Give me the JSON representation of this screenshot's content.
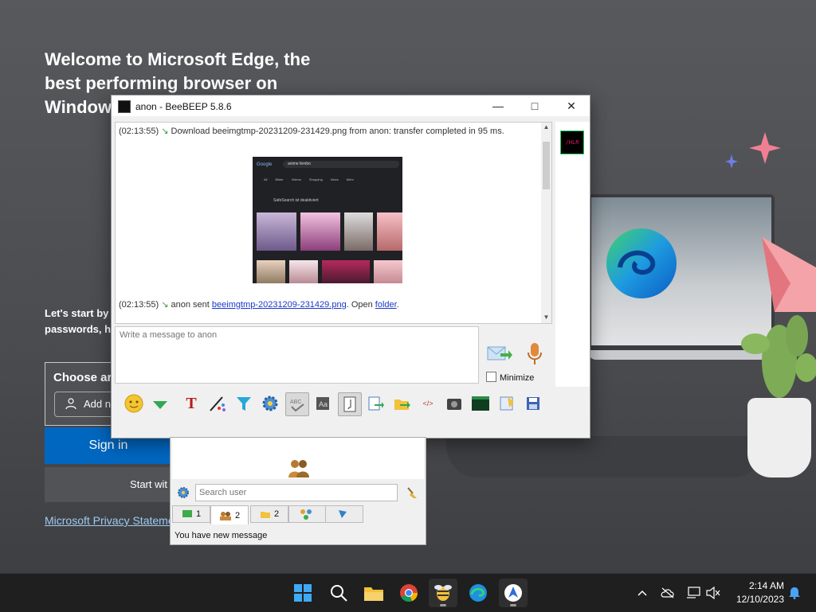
{
  "edge": {
    "welcome": "Welcome to Microsoft Edge, the best performing browser on Window",
    "lets_start_line1": "Let's start by",
    "lets_start_line2": "passwords, h",
    "choose_title": "Choose ar",
    "add_label": "Add ne",
    "sign_in": "Sign in",
    "start_with": "Start wit",
    "privacy": "Microsoft Privacy Stateme"
  },
  "beebeep": {
    "title": "anon - BeeBEEP 5.8.6",
    "avatar_text": "/HLR",
    "messages": {
      "m1": {
        "time": "(02:13:55)",
        "text": "Download beeimgtmp-20231209-231429.png from anon: transfer completed in 95 ms."
      },
      "m2": {
        "time": "(02:13:55)",
        "prefix": "anon sent",
        "file_link": "beeimgtmp-20231209-231429.png",
        "middle": ". Open",
        "folder_link": "folder",
        "suffix": "."
      }
    },
    "preview": {
      "search_text": "anime fembo",
      "tabs": [
        "All",
        "Bilder",
        "Videos",
        "Shopping",
        "News",
        "Mehr"
      ],
      "safesearch": "SafeSearch ist deaktiviert"
    },
    "input_placeholder": "Write a message to anon",
    "minimize_label": "Minimize",
    "toolbar_icons": [
      "emoticon-icon",
      "download-icon",
      "font-icon",
      "color-picker-icon",
      "filter-icon",
      "settings-icon",
      "spellcheck-icon",
      "dictionary-icon",
      "note-icon",
      "send-file-icon",
      "send-folder-icon",
      "html-icon",
      "screenshot-icon",
      "terminal-icon",
      "clear-icon",
      "save-icon"
    ]
  },
  "users_panel": {
    "search_placeholder": "Search user",
    "tabs": {
      "t1": {
        "count": "1"
      },
      "t2": {
        "count": "2"
      },
      "t3": {
        "count": "2"
      },
      "t4": {
        "count": ""
      },
      "t5": {
        "count": ""
      }
    },
    "status": "You have new message"
  },
  "taskbar": {
    "apps": [
      "windows-start-icon",
      "search-icon",
      "file-explorer-icon",
      "chrome-icon",
      "beebeep-icon",
      "edge-icon",
      "app-icon"
    ],
    "time": "2:14 AM",
    "date": "12/10/2023"
  },
  "colors": {
    "edge_blue": "#0067c0",
    "taskbar": "#1f1f1f",
    "link": "#1b39c9"
  }
}
